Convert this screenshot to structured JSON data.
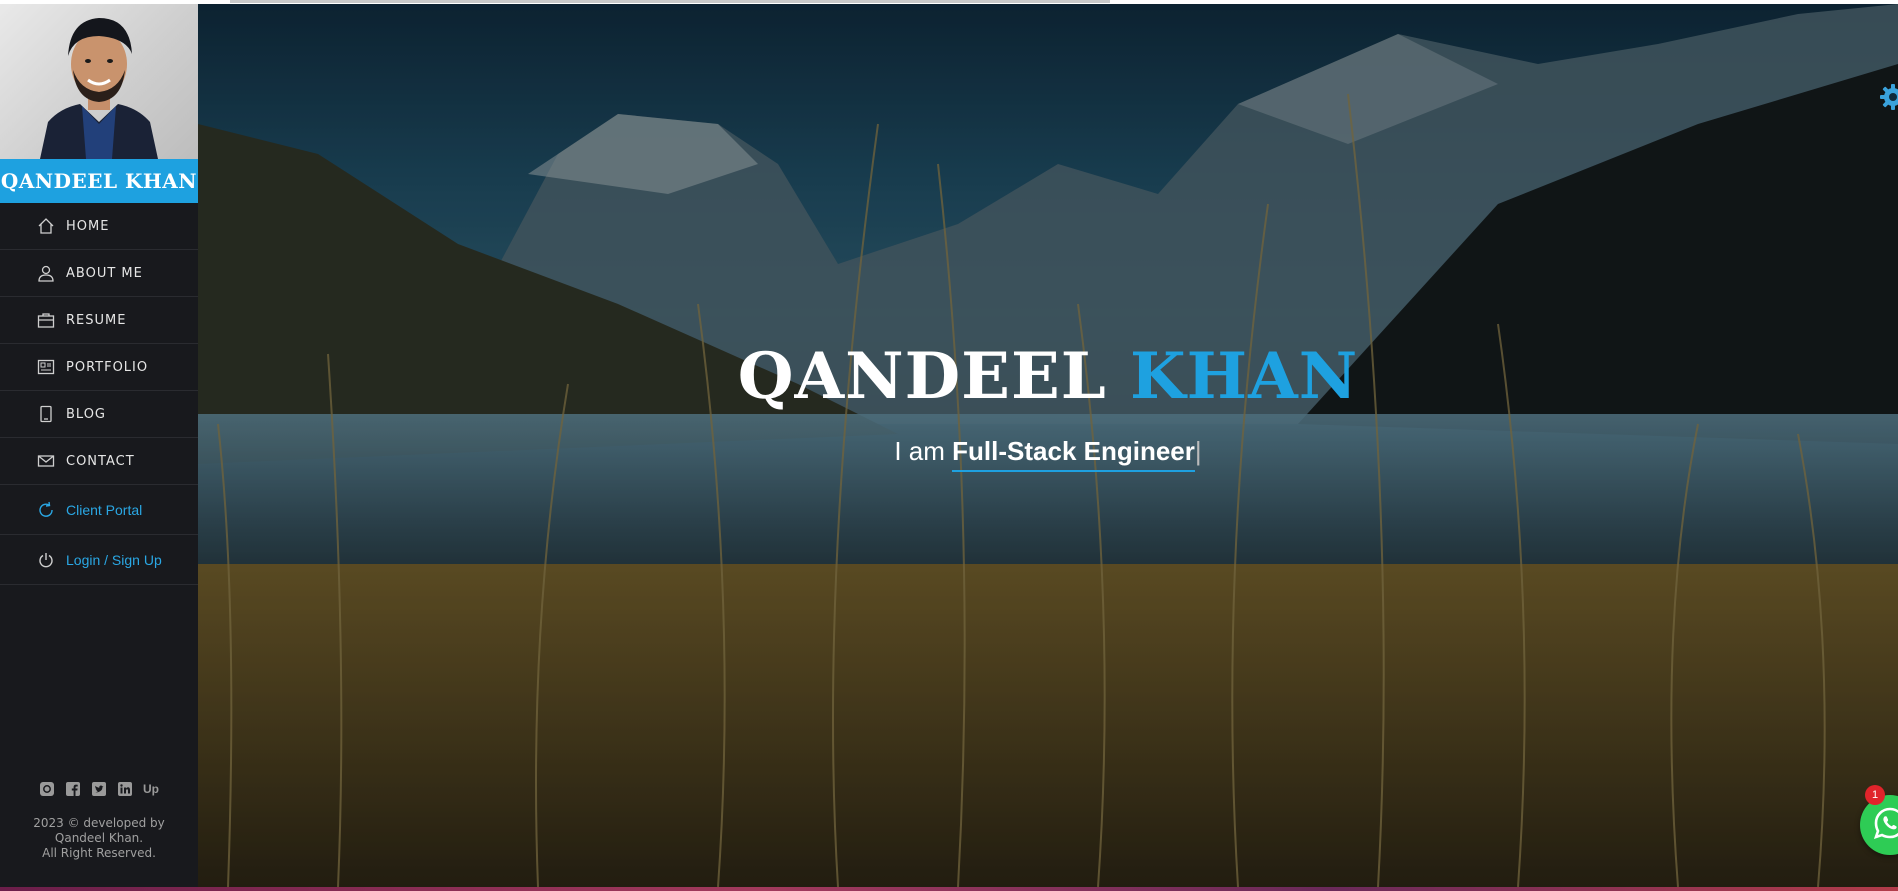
{
  "sidebar": {
    "name": "QANDEEL KHAN",
    "nav": [
      {
        "label": "HOME",
        "icon": "home-icon"
      },
      {
        "label": "ABOUT ME",
        "icon": "user-icon"
      },
      {
        "label": "RESUME",
        "icon": "briefcase-icon"
      },
      {
        "label": "PORTFOLIO",
        "icon": "portfolio-icon"
      },
      {
        "label": "BLOG",
        "icon": "tablet-icon"
      },
      {
        "label": "CONTACT",
        "icon": "mail-icon"
      },
      {
        "label": "Client Portal",
        "icon": "refresh-icon"
      },
      {
        "label": "Login / Sign Up",
        "icon": "power-icon"
      }
    ],
    "social": [
      "instagram-icon",
      "facebook-icon",
      "twitter-icon",
      "linkedin-icon",
      "upwork-icon"
    ],
    "upwork_text": "Up",
    "footer_line1": "2023 © developed by",
    "footer_line2": "Qandeel Khan.",
    "footer_line3": "All Right Reserved."
  },
  "hero": {
    "first_name": "QANDEEL",
    "last_name": "KHAN",
    "prefix": "I am",
    "role": "Full-Stack Engineer",
    "caret": "|"
  },
  "whatsapp": {
    "icon": "whatsapp-icon",
    "badge_count": "1"
  },
  "colors": {
    "accent": "#1ea1e0",
    "sidebar_bg": "#18191d",
    "whatsapp_green": "#2ecc55",
    "badge_red": "#e0242b"
  }
}
